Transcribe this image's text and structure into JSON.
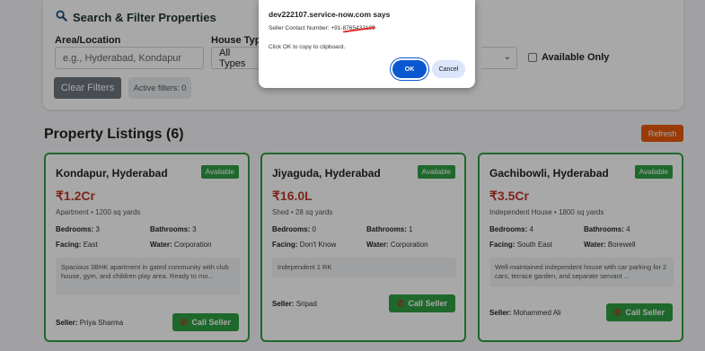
{
  "filters": {
    "title": "Search & Filter Properties",
    "area_label": "Area/Location",
    "area_placeholder": "e.g., Hyderabad, Kondapur",
    "house_type_label": "House Type",
    "house_type_value": "All Types",
    "available_only_label": "Available Only",
    "available_only_checked": false,
    "clear_label": "Clear Filters",
    "active_filters": "Active filters: 0"
  },
  "listings": {
    "title": "Property Listings (6)",
    "refresh_label": "Refresh",
    "cards": [
      {
        "location": "Kondapur, Hyderabad",
        "status": "Available",
        "price": "₹1.2Cr",
        "type_area": "Apartment • 1200 sq yards",
        "bedrooms_label": "Bedrooms:",
        "bedrooms": "3",
        "bathrooms_label": "Bathrooms:",
        "bathrooms": "3",
        "facing_label": "Facing:",
        "facing": "East",
        "water_label": "Water:",
        "water": "Corporation",
        "description": "Spacious 3BHK apartment in gated community with club house, gym, and children play area. Ready to mo...",
        "seller_label": "Seller:",
        "seller": "Priya Sharma",
        "call_label": "Call Seller"
      },
      {
        "location": "Jiyaguda, Hyderabad",
        "status": "Available",
        "price": "₹16.0L",
        "type_area": "Shed • 28 sq yards",
        "bedrooms_label": "Bedrooms:",
        "bedrooms": "0",
        "bathrooms_label": "Bathrooms:",
        "bathrooms": "1",
        "facing_label": "Facing:",
        "facing": "Don't Know",
        "water_label": "Water:",
        "water": "Corporation",
        "description": "Independent 1 RK",
        "seller_label": "Seller:",
        "seller": "Sripad",
        "call_label": "Call Seller"
      },
      {
        "location": "Gachibowli, Hyderabad",
        "status": "Available",
        "price": "₹3.5Cr",
        "type_area": "Independent House • 1800 sq yards",
        "bedrooms_label": "Bedrooms:",
        "bedrooms": "4",
        "bathrooms_label": "Bathrooms:",
        "bathrooms": "4",
        "facing_label": "Facing:",
        "facing": "South East",
        "water_label": "Water:",
        "water": "Borewell",
        "description": "Well-maintained independent house with car parking for 2 cars, terrace garden, and separate servant ...",
        "seller_label": "Seller:",
        "seller": "Mohammed Ali",
        "call_label": "Call Seller"
      }
    ]
  },
  "dialog": {
    "title": "dev222107.service-now.com says",
    "message_prefix": "Seller Contact Number: +91-",
    "message_number": "8765432109",
    "note": "Click OK to copy to clipboard.",
    "ok_label": "OK",
    "cancel_label": "Cancel"
  },
  "colors": {
    "accent_green": "#2f9e44",
    "price_red": "#c0392b",
    "refresh_orange": "#e8590c",
    "dialog_blue": "#0b57d0"
  }
}
